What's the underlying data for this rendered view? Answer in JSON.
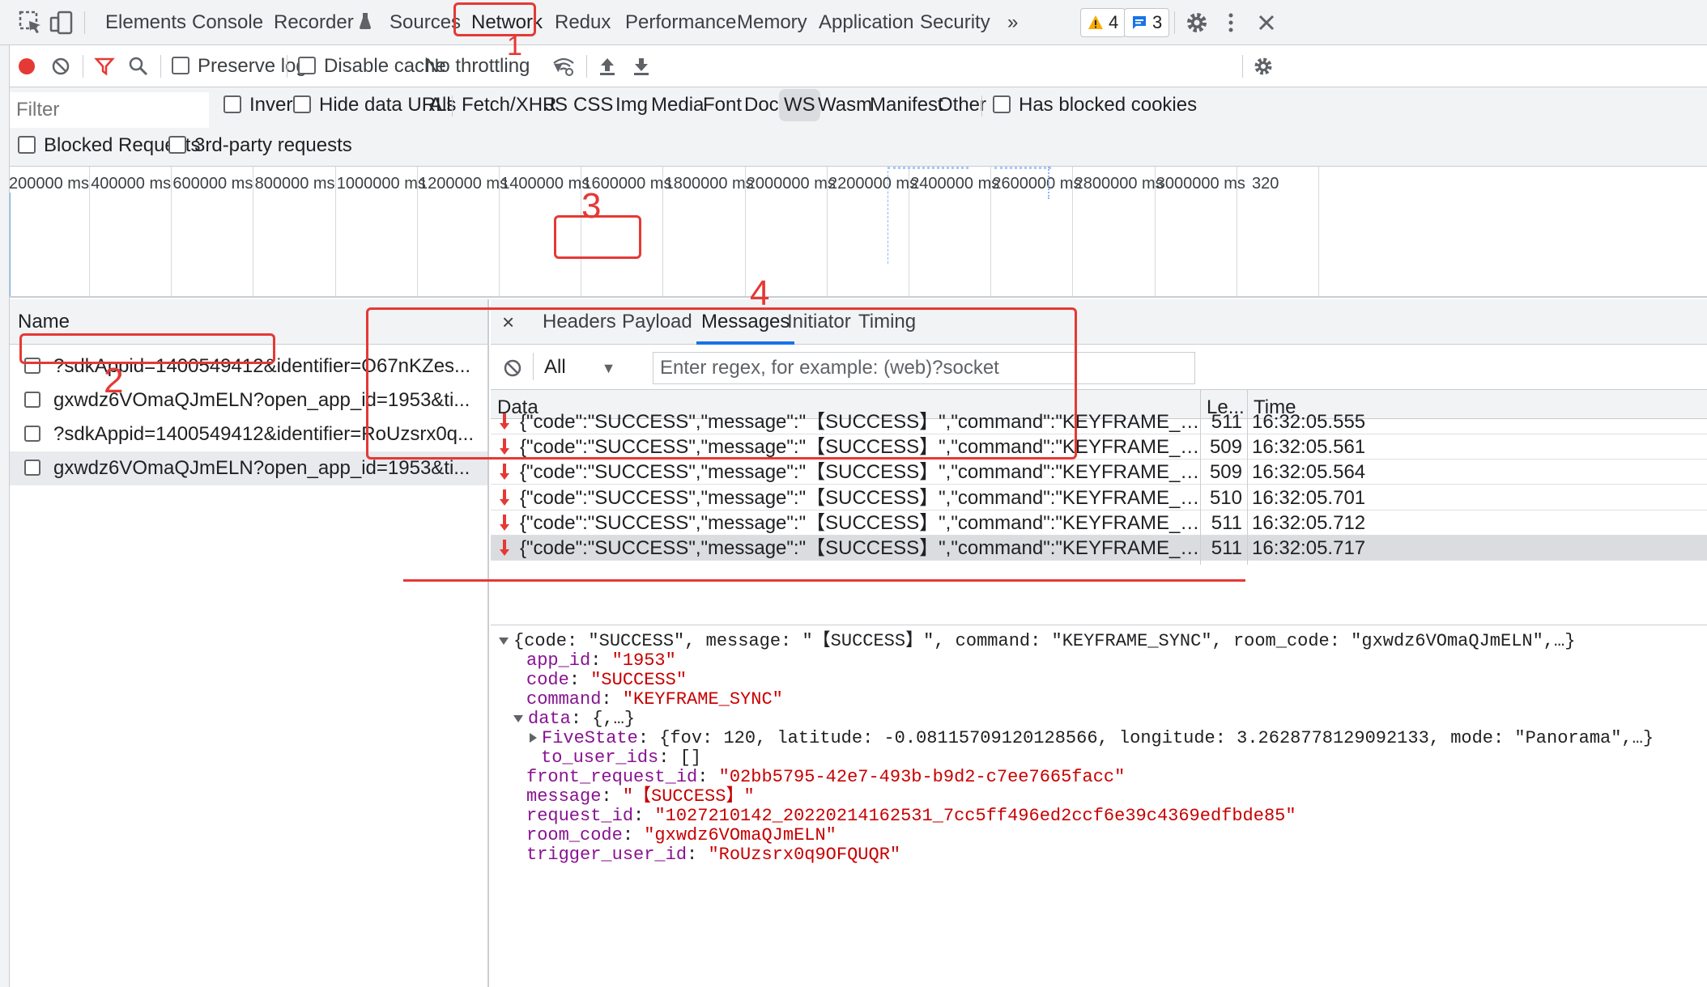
{
  "topbar": {
    "tabs": [
      "Elements",
      "Console",
      "Recorder",
      "Sources",
      "Network",
      "Redux",
      "Performance",
      "Memory",
      "Application",
      "Security"
    ],
    "more": "»",
    "warnings_count": "4",
    "messages_count": "3"
  },
  "toolbar": {
    "preserve_log": "Preserve log",
    "disable_cache": "Disable cache",
    "throttling": "No throttling"
  },
  "filter": {
    "placeholder": "Filter",
    "invert": "Invert",
    "hide_data_urls": "Hide data URLs",
    "types": [
      "All",
      "Fetch/XHR",
      "JS",
      "CSS",
      "Img",
      "Media",
      "Font",
      "Doc",
      "WS",
      "Wasm",
      "Manifest",
      "Other"
    ],
    "selected_type": "WS",
    "has_blocked_cookies": "Has blocked cookies",
    "blocked_requests": "Blocked Requests",
    "third_party": "3rd-party requests"
  },
  "timeline": {
    "ticks": [
      "200000 ms",
      "400000 ms",
      "600000 ms",
      "800000 ms",
      "1000000 ms",
      "1200000 ms",
      "1400000 ms",
      "1600000 ms",
      "1800000 ms",
      "2000000 ms",
      "2200000 ms",
      "2400000 ms",
      "2600000 ms",
      "2800000 ms",
      "3000000 ms",
      "320"
    ]
  },
  "name_pane": {
    "header": "Name",
    "rows": [
      "?sdkAppid=1400549412&identifier=O67nKZes...",
      "gxwdz6VOmaQJmELN?open_app_id=1953&ti...",
      "?sdkAppid=1400549412&identifier=RoUzsrx0q...",
      "gxwdz6VOmaQJmELN?open_app_id=1953&ti..."
    ]
  },
  "detail": {
    "close": "×",
    "tabs": [
      "Headers",
      "Payload",
      "Messages",
      "Initiator",
      "Timing"
    ],
    "active_tab": "Messages",
    "msg_filter": "All",
    "regex_placeholder": "Enter regex, for example: (web)?socket",
    "columns": [
      "Data",
      "Le...",
      "Time"
    ],
    "messages": [
      {
        "data": "{\"code\":\"SUCCESS\",\"message\":\"【SUCCESS】\",\"command\":\"KEYFRAME_SYNC\",\"room_code\":\"gx...",
        "len": "511",
        "time": "16:32:05.555"
      },
      {
        "data": "{\"code\":\"SUCCESS\",\"message\":\"【SUCCESS】\",\"command\":\"KEYFRAME_SYNC\",\"room_code\":\"gx...",
        "len": "509",
        "time": "16:32:05.561"
      },
      {
        "data": "{\"code\":\"SUCCESS\",\"message\":\"【SUCCESS】\",\"command\":\"KEYFRAME_SYNC\",\"room_code\":\"gx...",
        "len": "509",
        "time": "16:32:05.564"
      },
      {
        "data": "{\"code\":\"SUCCESS\",\"message\":\"【SUCCESS】\",\"command\":\"KEYFRAME_SYNC\",\"room_code\":\"gx...",
        "len": "510",
        "time": "16:32:05.701"
      },
      {
        "data": "{\"code\":\"SUCCESS\",\"message\":\"【SUCCESS】\",\"command\":\"KEYFRAME_SYNC\",\"room_code\":\"gx...",
        "len": "511",
        "time": "16:32:05.712"
      },
      {
        "data": "{\"code\":\"SUCCESS\",\"message\":\"【SUCCESS】\",\"command\":\"KEYFRAME_SYNC\",\"room_code\":\"gx...",
        "len": "511",
        "time": "16:32:05.717"
      }
    ],
    "json": {
      "summary": "{code: \"SUCCESS\", message: \"【SUCCESS】\", command: \"KEYFRAME_SYNC\", room_code: \"gxwdz6VOmaQJmELN\",…}",
      "app_id_key": "app_id",
      "app_id_val": "\"1953\"",
      "code_key": "code",
      "code_val": "\"SUCCESS\"",
      "command_key": "command",
      "command_val": "\"KEYFRAME_SYNC\"",
      "data_key": "data",
      "data_val": "{,…}",
      "fivestate_key": "FiveState",
      "fivestate_val": "{fov: 120, latitude: -0.08115709120128566, longitude: 3.2628778129092133, mode: \"Panorama\",…}",
      "to_user_ids_key": "to_user_ids",
      "to_user_ids_val": "[]",
      "front_request_id_key": "front_request_id",
      "front_request_id_val": "\"02bb5795-42e7-493b-b9d2-c7ee7665facc\"",
      "message_key": "message",
      "message_val": "\"【SUCCESS】\"",
      "request_id_key": "request_id",
      "request_id_val": "\"1027210142_20220214162531_7cc5ff496ed2ccf6e39c4369edfbde85\"",
      "room_code_key": "room_code",
      "room_code_val": "\"gxwdz6VOmaQJmELN\"",
      "trigger_user_id_key": "trigger_user_id",
      "trigger_user_id_val": "\"RoUzsrx0q9OFQUQR\""
    }
  },
  "annotations": {
    "n1": "1",
    "n2": "2",
    "n3": "3",
    "n4": "4"
  },
  "colors": {
    "accent": "#1a73e8",
    "record": "#e53935",
    "annotation": "#e53935",
    "json_key": "#881391",
    "json_string": "#c80000"
  }
}
